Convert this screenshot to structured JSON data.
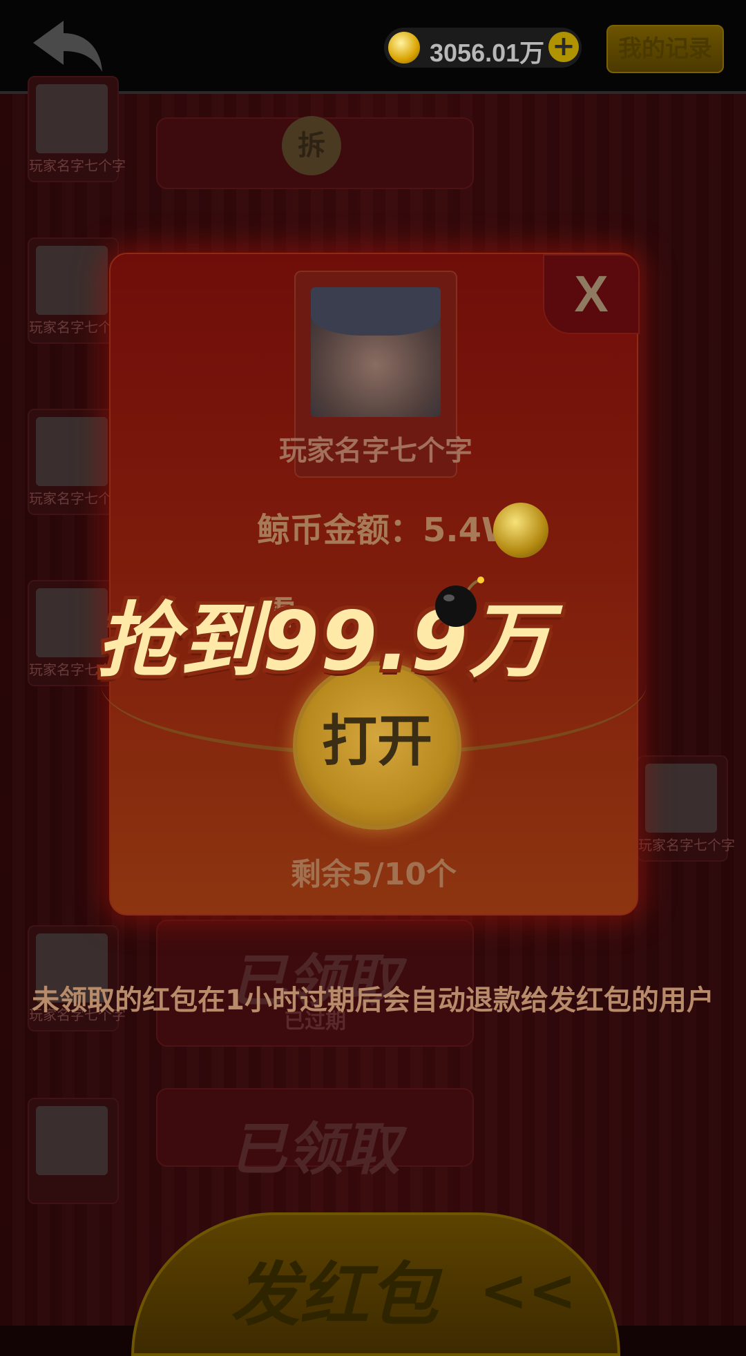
{
  "topbar": {
    "coin_value": "3056.01万",
    "plus_symbol": "+",
    "record_label": "我的记录"
  },
  "background": {
    "player_name": "玩家名字七个字",
    "chai_label": "拆",
    "claimed_label": "已领取",
    "expired_label": "已过期",
    "send_label": "发红包",
    "send_arrow": "<<"
  },
  "popup": {
    "close_label": "X",
    "sender_name": "玩家名字七个字",
    "amount_text": "鲸币金额：5.4W",
    "mine_text": "雷",
    "open_label": "打开",
    "remaining_text": "剩余5/10个"
  },
  "notice": "未领取的红包在1小时过期后会自动退款给发红包的用户",
  "grab_banner": "抢到99.9万",
  "colors": {
    "popup_red": "#7d1b0c",
    "gold": "#d4a63e",
    "banner_text": "#ffe9a8"
  }
}
